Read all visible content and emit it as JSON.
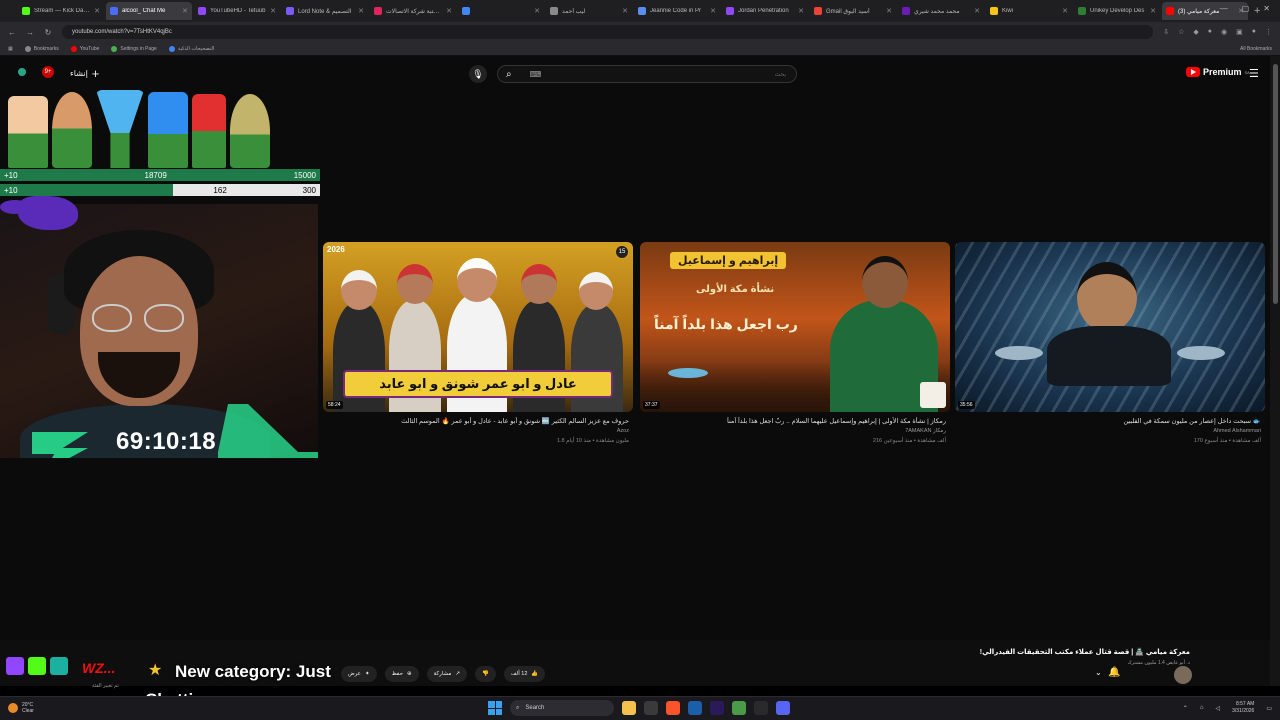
{
  "browser": {
    "tabs": [
      {
        "title": "Stream — Kick Dashb",
        "color": "#53fc18",
        "active": false
      },
      {
        "title": "alcool_ Chat Me",
        "color": "#4a6cf7",
        "active": true
      },
      {
        "title": "YouTubeHD - Tetuub",
        "color": "#9146ff",
        "active": false
      },
      {
        "title": "Lord Note & التصميم",
        "color": "#7a5af8",
        "active": false
      },
      {
        "title": "ترتيب مكتبة شركة الاتصالات",
        "color": "#e0245e",
        "active": false
      },
      {
        "title": "",
        "color": "#4285f4",
        "active": false
      },
      {
        "title": "ليب أحمد",
        "color": "#8a8a8a",
        "active": false
      },
      {
        "title": "Jeannie Code in Pr",
        "color": "#5a8dee",
        "active": false
      },
      {
        "title": "Jordan Penetration",
        "color": "#9146ff",
        "active": false
      },
      {
        "title": "Gmail أسيد البوق",
        "color": "#ea4335",
        "active": false
      },
      {
        "title": "محمد محمد شيري",
        "color": "#6a1bb8",
        "active": false
      },
      {
        "title": "Kiwi",
        "color": "#f5c518",
        "active": false
      },
      {
        "title": "Unikey Develop Des",
        "color": "#2e7d32",
        "active": false
      },
      {
        "title": "معركة ميامي (3) ",
        "color": "#ff0000",
        "active": true
      }
    ],
    "new_tab": "+",
    "url": "youtube.com/watch?v=7TsHtKV4qjBc",
    "bookmarks": [
      {
        "label": "Bookmarks",
        "color": "#888888"
      },
      {
        "label": "YouTube",
        "color": "#ff0000"
      },
      {
        "label": "Settings in Page",
        "color": "#4caf50"
      },
      {
        "label": "التصحيحات الذكية",
        "color": "#4285f4"
      }
    ],
    "bookmarks_right": "All Bookmarks"
  },
  "youtube": {
    "create_label": "إنشاء",
    "notification_count": "9+",
    "search_placeholder": "بحث",
    "premium_label": "Premium",
    "premium_region": "SA",
    "videos": [
      {
        "thumb_banner": "عادل و ابو عمر  شونق و ابو عابد",
        "thumb_tag": "2026",
        "thumb_badge": "15",
        "duration": "58:24",
        "title": "حروف مع عزيز السالم الكثير 🔤 شونق و أبو عابد - عادل و أبو عمر 🔥 الموسم الثالث",
        "channel": "Azoz",
        "meta": "1.8 مليون مشاهدة • منذ 10 أيام"
      },
      {
        "thumb_title": "إبراهيم و إسماعيل",
        "thumb_subtitle": "نشأة مكة الأولى",
        "thumb_verse": "رب اجعل هذا بلداً آمناً",
        "duration": "37:37",
        "title": "رمكاز | نشأة مكة الأولى | إبراهيم وإسماعيل عليهما السلام .. ربّ اجعل هذا بلداً آمناً",
        "channel": "7AMAKAN رمكاز",
        "meta": "216 ألف مشاهدة • منذ أسبوعين"
      },
      {
        "duration": "35:56",
        "title": "سبحت داخل إعصار من مليون سمكة في الفلبين 🐟",
        "channel": "Ahmed Alshammari",
        "meta": "170 ألف مشاهدة • منذ أسبوع"
      }
    ],
    "mini_player": {
      "title": "معركة ميامي 🏯 | قصة قتال عملاء مكتب التحقيقات الفيدرالي!",
      "channel": "د. أبو عايض",
      "subs": "1.4 مليون مشترك"
    },
    "actions": [
      {
        "label": "12 ألف",
        "icon": "like-icon"
      },
      {
        "label": "",
        "icon": "dislike-icon"
      },
      {
        "label": "مشاركة",
        "icon": "share-icon"
      },
      {
        "label": "حفظ",
        "icon": "save-icon"
      },
      {
        "label": "عرض",
        "icon": "sparkle-icon"
      }
    ]
  },
  "stream": {
    "hp_bar_1": {
      "left": "+10",
      "mid": "18709",
      "right": "15000"
    },
    "hp_bar_2": {
      "left": "+10",
      "mid": "162",
      "right": "300",
      "fill": 0.54
    },
    "timer": "69:10:18",
    "alert_prefix": "WZ...",
    "alert_sub": "تم تغيير الفئة",
    "alert_text": "New category: Just Chatting"
  },
  "taskbar": {
    "weather_temp": "20°C",
    "weather_desc": "Clear",
    "search_label": "Search",
    "time": "8:57 AM",
    "date": "3/31/2026"
  }
}
